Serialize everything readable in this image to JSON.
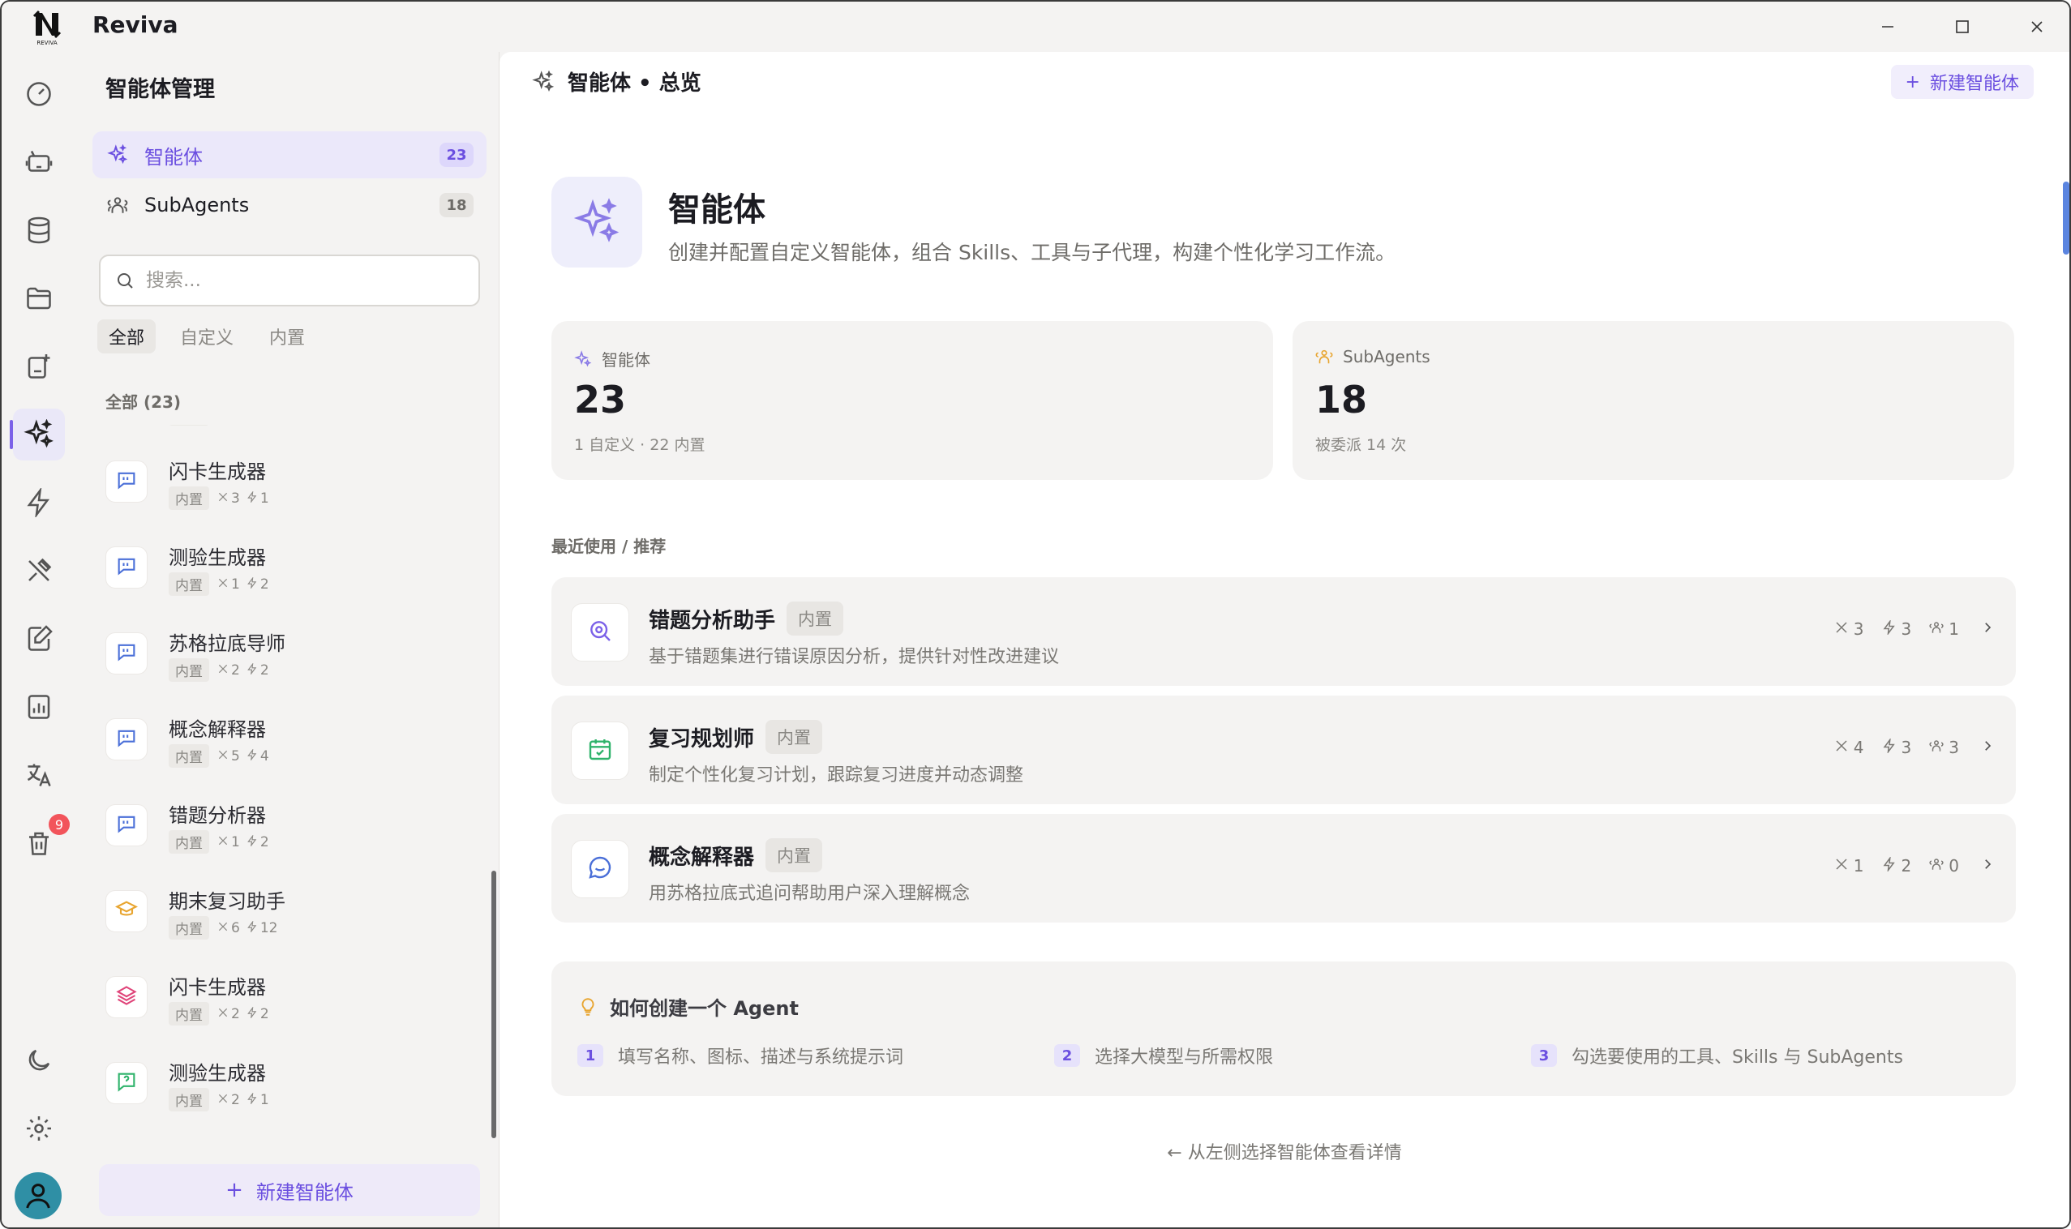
{
  "app": {
    "title": "Reviva",
    "logo_text": "REVIVA"
  },
  "window_controls": {
    "minimize": "minimize-icon",
    "maximize": "maximize-icon",
    "close": "close-icon"
  },
  "rail": {
    "items": [
      {
        "icon": "dashboard-icon"
      },
      {
        "icon": "robot-icon"
      },
      {
        "icon": "database-icon"
      },
      {
        "icon": "folder-icon"
      },
      {
        "icon": "note-add-icon"
      },
      {
        "icon": "sparkles-icon",
        "active": true
      },
      {
        "icon": "lightning-icon"
      },
      {
        "icon": "tools-icon"
      },
      {
        "icon": "edit-doc-icon"
      },
      {
        "icon": "chart-icon"
      },
      {
        "icon": "translate-icon"
      },
      {
        "icon": "trash-icon",
        "badge": "9"
      }
    ],
    "bottom": [
      {
        "icon": "moon-icon"
      },
      {
        "icon": "settings-icon"
      },
      {
        "icon": "avatar-icon"
      }
    ]
  },
  "sidebar": {
    "title": "智能体管理",
    "nav": [
      {
        "label": "智能体",
        "count": "23"
      },
      {
        "label": "SubAgents",
        "count": "18"
      }
    ],
    "search_placeholder": "搜索...",
    "filters": [
      "全部",
      "自定义",
      "内置"
    ],
    "group_label": "全部 (23)",
    "items": [
      {
        "name": "闪卡生成器",
        "tag": "内置",
        "tools": "3",
        "skills": "1",
        "icon": "quote-icon"
      },
      {
        "name": "测验生成器",
        "tag": "内置",
        "tools": "1",
        "skills": "2",
        "icon": "quote-icon"
      },
      {
        "name": "苏格拉底导师",
        "tag": "内置",
        "tools": "2",
        "skills": "2",
        "icon": "quote-icon"
      },
      {
        "name": "概念解释器",
        "tag": "内置",
        "tools": "5",
        "skills": "4",
        "icon": "quote-icon"
      },
      {
        "name": "错题分析器",
        "tag": "内置",
        "tools": "1",
        "skills": "2",
        "icon": "quote-icon"
      },
      {
        "name": "期末复习助手",
        "tag": "内置",
        "tools": "6",
        "skills": "12",
        "icon": "graduation-cap-icon"
      },
      {
        "name": "闪卡生成器",
        "tag": "内置",
        "tools": "2",
        "skills": "2",
        "icon": "layers-icon"
      },
      {
        "name": "测验生成器",
        "tag": "内置",
        "tools": "2",
        "skills": "1",
        "icon": "question-icon"
      }
    ],
    "new_button": "新建智能体"
  },
  "main": {
    "header": "智能体 • 总览",
    "new_button": "新建智能体",
    "hero": {
      "title": "智能体",
      "subtitle": "创建并配置自定义智能体，组合 Skills、工具与子代理，构建个性化学习工作流。"
    },
    "stats": [
      {
        "label": "智能体",
        "value": "23",
        "note": "1 自定义 · 22 内置"
      },
      {
        "label": "SubAgents",
        "value": "18",
        "note": "被委派 14 次"
      }
    ],
    "section_label": "最近使用 / 推荐",
    "agents": [
      {
        "title": "错题分析助手",
        "tag": "内置",
        "desc": "基于错题集进行错误原因分析，提供针对性改进建议",
        "tools": "3",
        "skills": "3",
        "subagents": "1",
        "icon": "search-analyze-icon",
        "color": "#7b61e8"
      },
      {
        "title": "复习规划师",
        "tag": "内置",
        "desc": "制定个性化复习计划，跟踪复习进度并动态调整",
        "tools": "4",
        "skills": "3",
        "subagents": "3",
        "icon": "calendar-check-icon",
        "color": "#2fb36b"
      },
      {
        "title": "概念解释器",
        "tag": "内置",
        "desc": "用苏格拉底式追问帮助用户深入理解概念",
        "tools": "1",
        "skills": "2",
        "subagents": "0",
        "icon": "chat-bubble-icon",
        "color": "#4a6fd8"
      }
    ],
    "howto": {
      "title": "如何创建一个 Agent",
      "steps": [
        {
          "num": "1",
          "text": "填写名称、图标、描述与系统提示词"
        },
        {
          "num": "2",
          "text": "选择大模型与所需权限"
        },
        {
          "num": "3",
          "text": "勾选要使用的工具、Skills 与 SubAgents"
        }
      ]
    },
    "footer_hint": "从左侧选择智能体查看详情"
  },
  "colors": {
    "accent": "#6b4fe0",
    "badge": "#f2545b"
  }
}
